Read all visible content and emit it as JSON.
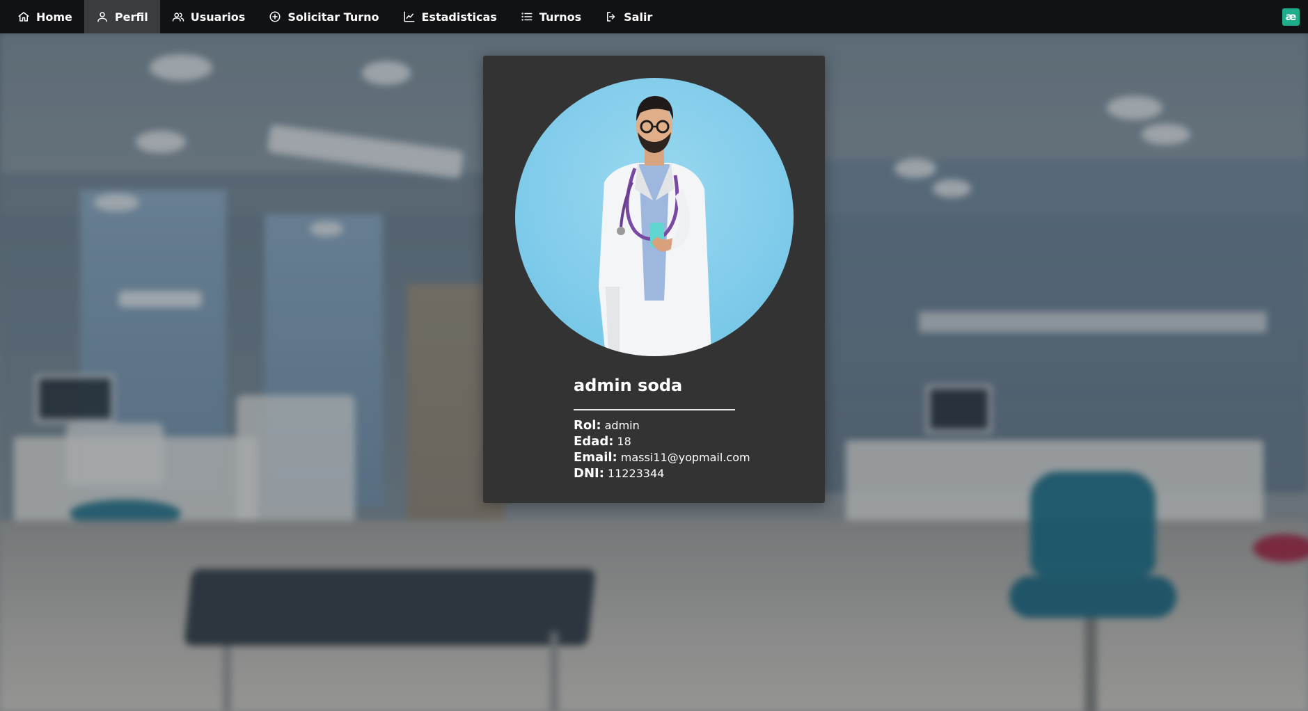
{
  "navbar": {
    "items": [
      {
        "label": "Home",
        "icon": "home-icon",
        "active": false
      },
      {
        "label": "Perfil",
        "icon": "user-icon",
        "active": true
      },
      {
        "label": "Usuarios",
        "icon": "users-icon",
        "active": false
      },
      {
        "label": "Solicitar Turno",
        "icon": "plus-circle-icon",
        "active": false
      },
      {
        "label": "Estadisticas",
        "icon": "chart-line-icon",
        "active": false
      },
      {
        "label": "Turnos",
        "icon": "list-icon",
        "active": false
      },
      {
        "label": "Salir",
        "icon": "logout-icon",
        "active": false
      }
    ],
    "brand_badge": "æ",
    "active_color": "#3a3c3f",
    "background_color": "#111214",
    "badge_color": "#1fae8c"
  },
  "profile": {
    "name": "admin soda",
    "avatar_icon": "doctor-avatar-icon",
    "fields": [
      {
        "label": "Rol:",
        "value": "admin"
      },
      {
        "label": "Edad:",
        "value": "18"
      },
      {
        "label": "Email:",
        "value": "massi11@yopmail.com"
      },
      {
        "label": "DNI:",
        "value": "11223344"
      }
    ],
    "card_color": "#333333"
  }
}
